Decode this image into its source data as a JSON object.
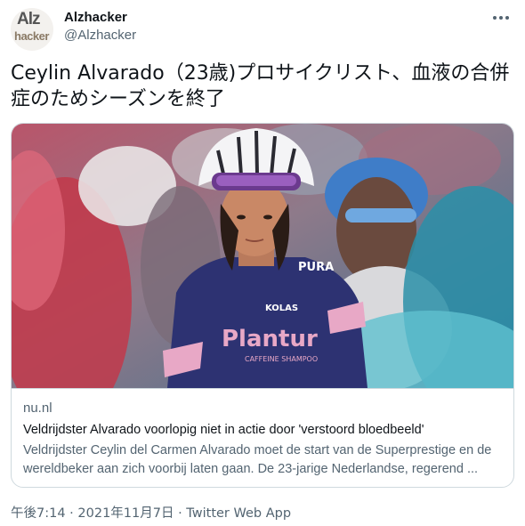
{
  "author": {
    "avatar_text_1": "Alz",
    "avatar_text_2": "hacker",
    "display_name": "Alzhacker",
    "handle": "@Alzhacker"
  },
  "menu": {
    "icon": "more-horizontal-icon"
  },
  "tweet": {
    "text": "Ceylin Alvarado（23歳)プロサイクリスト、血液の合併症のためシーズンを終了"
  },
  "link_card": {
    "domain": "nu.nl",
    "title": "Veldrijdster Alvarado voorlopig niet in actie door 'verstoord bloedbeeld'",
    "description": "Veldrijdster Ceylin del Carmen Alvarado moet de start van de Superprestige en de wereldbeker aan zich voorbij laten gaan. De 23-jarige Nederlandse, regerend ...",
    "image": {
      "jersey_text_1": "Plantur",
      "jersey_text_2": "CAFFEINE SHAMPOO",
      "jersey_text_3": "KOLAS",
      "jersey_text_4": "PURA",
      "colors": {
        "jersey": "#2d3272",
        "accent": "#e8a8c6"
      }
    }
  },
  "footer": {
    "timestamp": "午後7:14 · 2021年11月7日 · Twitter Web App"
  },
  "colors": {
    "text_primary": "#0f1419",
    "text_secondary": "#536471",
    "border": "#cfd9de"
  }
}
